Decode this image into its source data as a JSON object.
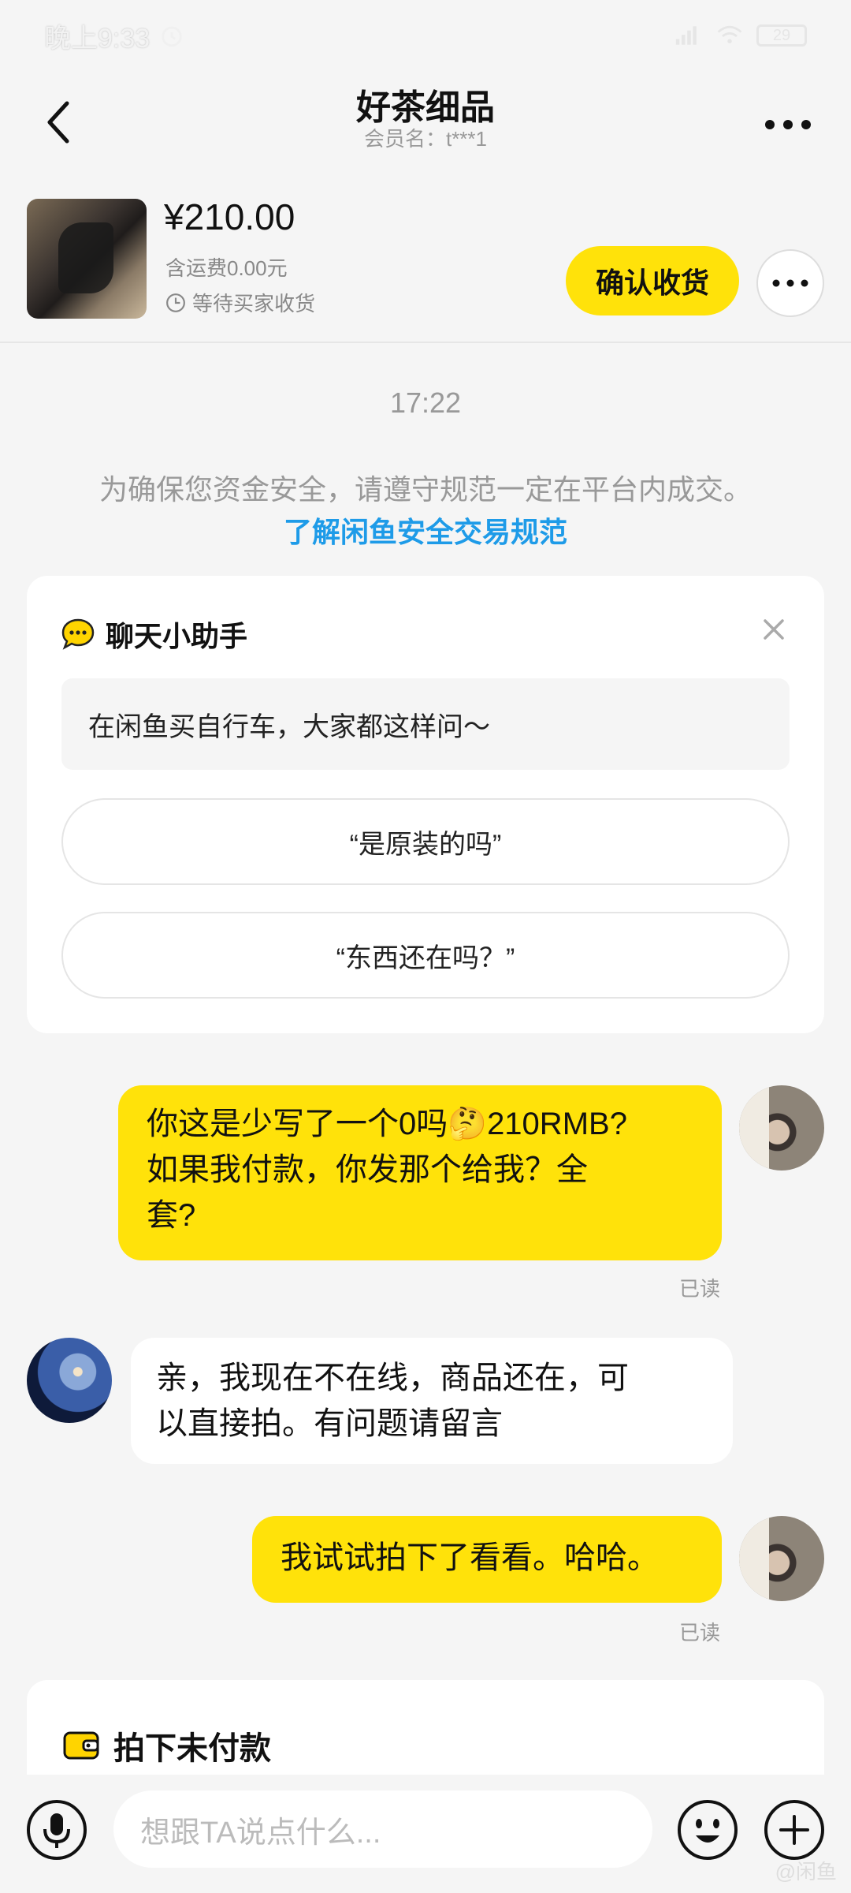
{
  "status_bar": {
    "time": "晚上9:33",
    "battery": "29"
  },
  "header": {
    "title": "好茶细品",
    "subtitle": "会员名：t***1",
    "back_icon": "chevron-left-icon",
    "more_icon": "more-horizontal-icon"
  },
  "order": {
    "price": "¥210.00",
    "shipping": "含运费0.00元",
    "status": "等待买家收货",
    "confirm_label": "确认收货"
  },
  "chat": {
    "time": "17:22",
    "notice": "为确保您资金安全，请遵守规范一定在平台内成交。",
    "notice_link": "了解闲鱼安全交易规范"
  },
  "assistant": {
    "title": "聊天小助手",
    "prompt": "在闲鱼买自行车，大家都这样问～",
    "suggestions": [
      "“是原装的吗”",
      "“东西还在吗？”"
    ]
  },
  "messages": [
    {
      "from": "me",
      "text_a": "你这是少写了一个0吗",
      "emoji": "🤔",
      "text_b": "210RMB?",
      "text_c": "如果我付款，你发那个给我？全",
      "text_d": "套?",
      "read": "已读"
    },
    {
      "from": "other",
      "text_a": "亲，我现在不在线，商品还在，可",
      "text_b": "以直接拍。有问题请留言"
    },
    {
      "from": "me",
      "text_a": "我试试拍下了看看。哈哈。",
      "read": "已读"
    }
  ],
  "unpaid": {
    "title": "拍下未付款"
  },
  "input": {
    "placeholder": "想跟TA说点什么..."
  },
  "watermark": "@闲鱼"
}
